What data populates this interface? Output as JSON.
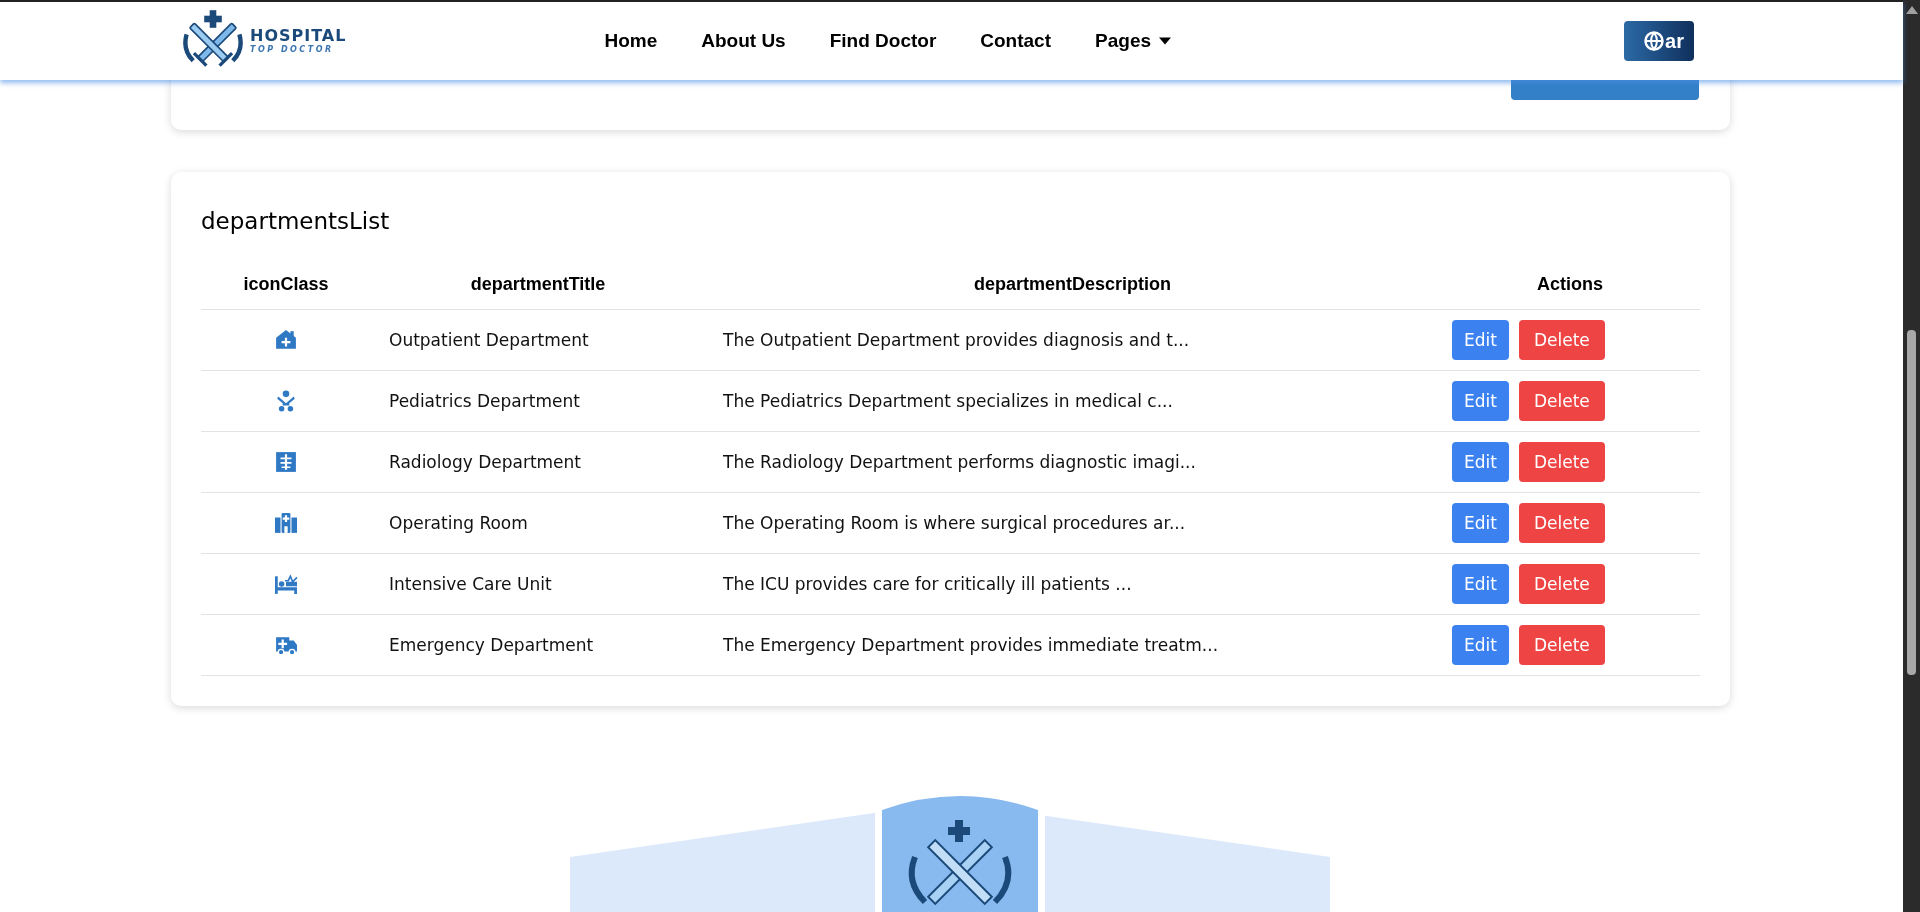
{
  "header": {
    "logo": {
      "title": "HOSPITAL",
      "subtitle": "TOP DOCTOR"
    },
    "nav": [
      {
        "label": "Home",
        "dropdown": false
      },
      {
        "label": "About Us",
        "dropdown": false
      },
      {
        "label": "Find Doctor",
        "dropdown": false
      },
      {
        "label": "Contact",
        "dropdown": false
      },
      {
        "label": "Pages",
        "dropdown": true
      }
    ],
    "language_button": "ar"
  },
  "departments": {
    "title": "departmentsList",
    "columns": [
      "iconClass",
      "departmentTitle",
      "departmentDescription",
      "Actions"
    ],
    "rows": [
      {
        "title": "Outpatient Department",
        "description": "The Outpatient Department provides diagnosis and t...",
        "actions": [
          "Edit",
          "Delete"
        ]
      },
      {
        "title": "Pediatrics Department",
        "description": "The Pediatrics Department specializes in medical c...",
        "actions": [
          "Edit",
          "Delete"
        ]
      },
      {
        "title": "Radiology Department",
        "description": "The Radiology Department performs diagnostic imagi...",
        "actions": [
          "Edit",
          "Delete"
        ]
      },
      {
        "title": "Operating Room",
        "description": "The Operating Room is where surgical procedures ar...",
        "actions": [
          "Edit",
          "Delete"
        ]
      },
      {
        "title": "Intensive Care Unit",
        "description": "The ICU provides care for critically ill patients ...",
        "actions": [
          "Edit",
          "Delete"
        ]
      },
      {
        "title": "Emergency Department",
        "description": "The Emergency Department provides immediate treatm...",
        "actions": [
          "Edit",
          "Delete"
        ]
      }
    ]
  }
}
